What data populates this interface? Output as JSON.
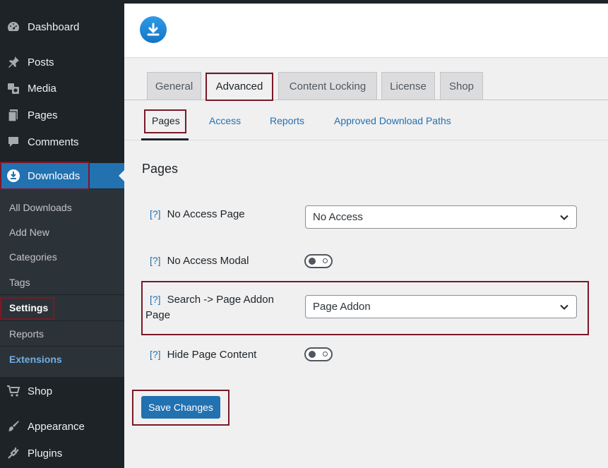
{
  "sidebar": {
    "items": [
      {
        "label": "Dashboard",
        "icon": "dashboard-icon"
      },
      {
        "label": "Posts",
        "icon": "pin-icon"
      },
      {
        "label": "Media",
        "icon": "media-icon"
      },
      {
        "label": "Pages",
        "icon": "pages-icon"
      },
      {
        "label": "Comments",
        "icon": "comment-icon"
      },
      {
        "label": "Downloads",
        "icon": "download-icon"
      },
      {
        "label": "Shop",
        "icon": "cart-icon"
      },
      {
        "label": "Appearance",
        "icon": "brush-icon"
      },
      {
        "label": "Plugins",
        "icon": "plug-icon"
      }
    ],
    "submenu": [
      "All Downloads",
      "Add New",
      "Categories",
      "Tags",
      "Settings",
      "Reports",
      "Extensions"
    ]
  },
  "tabs": [
    "General",
    "Advanced",
    "Content Locking",
    "License",
    "Shop"
  ],
  "subtabs": [
    "Pages",
    "Access",
    "Reports",
    "Approved Download Paths"
  ],
  "section_title": "Pages",
  "settings": {
    "help": "[?]",
    "no_access_page": {
      "label": "No Access Page",
      "value": "No Access"
    },
    "no_access_modal": {
      "label": "No Access Modal",
      "enabled": false
    },
    "search_page": {
      "label_line1": "Search -> Page Addon",
      "label_line2": "Page",
      "value": "Page Addon"
    },
    "hide_page_content": {
      "label": "Hide Page Content",
      "enabled": false
    }
  },
  "save_button": "Save Changes",
  "colors": {
    "accent": "#2271b1",
    "sidebar": "#1d2327",
    "highlight": "#7b1827"
  }
}
